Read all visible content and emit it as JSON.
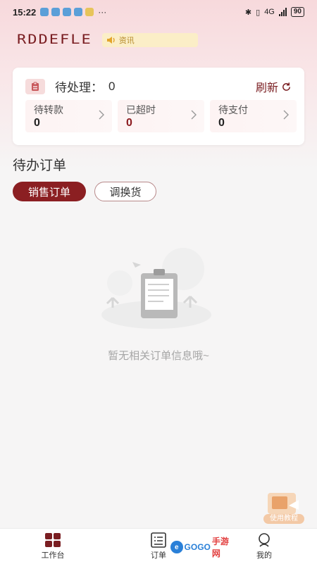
{
  "status_bar": {
    "time": "15:22",
    "more": "···",
    "network": "4G",
    "battery": "90"
  },
  "brand": {
    "logo_text": "RDDEFLE",
    "news_text": "资讯"
  },
  "summary_card": {
    "pending_label": "待处理：",
    "pending_count": "0",
    "refresh_label": "刷新",
    "stats": [
      {
        "label": "待转款",
        "value": "0"
      },
      {
        "label": "已超时",
        "value": "0"
      },
      {
        "label": "待支付",
        "value": "0"
      }
    ]
  },
  "orders_section": {
    "title": "待办订单",
    "tabs": [
      {
        "label": "销售订单",
        "active": true
      },
      {
        "label": "调换货",
        "active": false
      }
    ],
    "empty_text": "暂无相关订单信息哦~"
  },
  "tutorial": {
    "label": "使用教程"
  },
  "tabbar": {
    "items": [
      {
        "label": "工作台",
        "icon": "grid-icon"
      },
      {
        "label": "订单",
        "icon": "order-list-icon"
      },
      {
        "label": "我的",
        "icon": "person-icon"
      }
    ]
  },
  "watermark": {
    "text_a": "GOGO",
    "text_b": "手游网"
  },
  "colors": {
    "brand": "#8b1f22",
    "accent_bg": "#f7d9dc",
    "news_bg": "#fbeec7"
  }
}
